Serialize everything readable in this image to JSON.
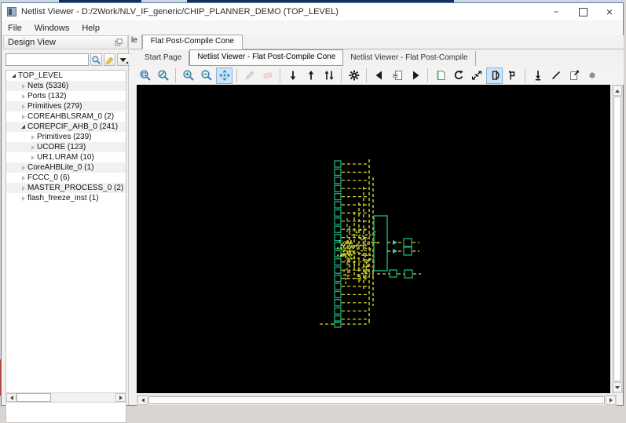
{
  "window": {
    "title": "Netlist Viewer - D:/2Work/NLV_IF_generic/CHIP_PLANNER_DEMO (TOP_LEVEL)",
    "controls": {
      "minimize": "−",
      "close": "×"
    }
  },
  "menu": {
    "items": [
      "File",
      "Windows",
      "Help"
    ]
  },
  "design_view": {
    "title": "Design View",
    "search": {
      "value": "",
      "placeholder": ""
    },
    "search_buttons": [
      "search-icon",
      "highlight-icon",
      "filter-dropdown-icon"
    ],
    "tree": [
      {
        "label": "TOP_LEVEL",
        "level": 0,
        "state": "expanded"
      },
      {
        "label": "Nets (5336)",
        "level": 1,
        "state": "collapsed"
      },
      {
        "label": "Ports (132)",
        "level": 1,
        "state": "collapsed"
      },
      {
        "label": "Primitives (279)",
        "level": 1,
        "state": "collapsed"
      },
      {
        "label": "COREAHBLSRAM_0 (2)",
        "level": 1,
        "state": "collapsed"
      },
      {
        "label": "COREPCIF_AHB_0 (241)",
        "level": 1,
        "state": "expanded"
      },
      {
        "label": "Primitives (239)",
        "level": 2,
        "state": "collapsed"
      },
      {
        "label": "UCORE (123)",
        "level": 2,
        "state": "collapsed"
      },
      {
        "label": "UR1.URAM (10)",
        "level": 2,
        "state": "collapsed"
      },
      {
        "label": "CoreAHBLite_0 (1)",
        "level": 1,
        "state": "collapsed"
      },
      {
        "label": "FCCC_0 (6)",
        "level": 1,
        "state": "collapsed"
      },
      {
        "label": "MASTER_PROCESS_0 (2)",
        "level": 1,
        "state": "collapsed"
      },
      {
        "label": "flash_freeze_inst (1)",
        "level": 1,
        "state": "collapsed"
      }
    ]
  },
  "doc_tabs": {
    "fragment": "le",
    "active": "Flat Post-Compile Cone"
  },
  "view_tabs": [
    {
      "label": "Start Page",
      "active": false
    },
    {
      "label": "Netlist Viewer - Flat Post-Compile Cone",
      "active": true
    },
    {
      "label": "Netlist Viewer - Flat Post-Compile",
      "active": false
    }
  ],
  "toolbar": {
    "groups": [
      [
        {
          "name": "zoom-window",
          "icon": "zoom-window"
        },
        {
          "name": "zoom-fit",
          "icon": "zoom-fit"
        }
      ],
      [
        {
          "name": "zoom-in",
          "icon": "zoom-in"
        },
        {
          "name": "zoom-out",
          "icon": "zoom-out"
        },
        {
          "name": "pan-tool",
          "icon": "pan",
          "state": "active"
        }
      ],
      [
        {
          "name": "edit-pencil",
          "icon": "pencil",
          "state": "disabled"
        },
        {
          "name": "eraser",
          "icon": "eraser",
          "state": "disabled"
        }
      ],
      [
        {
          "name": "push-down",
          "icon": "arrow-down"
        },
        {
          "name": "pop-up",
          "icon": "arrow-up"
        },
        {
          "name": "push-pop",
          "icon": "arrows-up-down"
        }
      ],
      [
        {
          "name": "settings",
          "icon": "gear"
        }
      ],
      [
        {
          "name": "previous-sheet",
          "icon": "triangle-left"
        },
        {
          "name": "current-sheet",
          "icon": "page-minus"
        },
        {
          "name": "next-sheet",
          "icon": "triangle-right"
        }
      ],
      [
        {
          "name": "new-sheet",
          "icon": "page"
        },
        {
          "name": "reload",
          "icon": "rotate"
        },
        {
          "name": "collapse-view",
          "icon": "collapse-arrows"
        },
        {
          "name": "cone-view",
          "icon": "cone",
          "state": "active"
        },
        {
          "name": "orthogonal-route",
          "icon": "ortho"
        }
      ],
      [
        {
          "name": "probe-down",
          "icon": "probe-down"
        },
        {
          "name": "draw-line",
          "icon": "slash"
        },
        {
          "name": "export-sheet",
          "icon": "page-export"
        },
        {
          "name": "record-dot",
          "icon": "dot"
        }
      ]
    ]
  },
  "canvas": {
    "background": "#000000",
    "diagram": {
      "port_color": "#17b479",
      "wire_color": "#d2d42f",
      "accent_color": "#2fd8a8",
      "left_port_count": 20,
      "has_center_block": true,
      "right_port_count": 4
    }
  }
}
